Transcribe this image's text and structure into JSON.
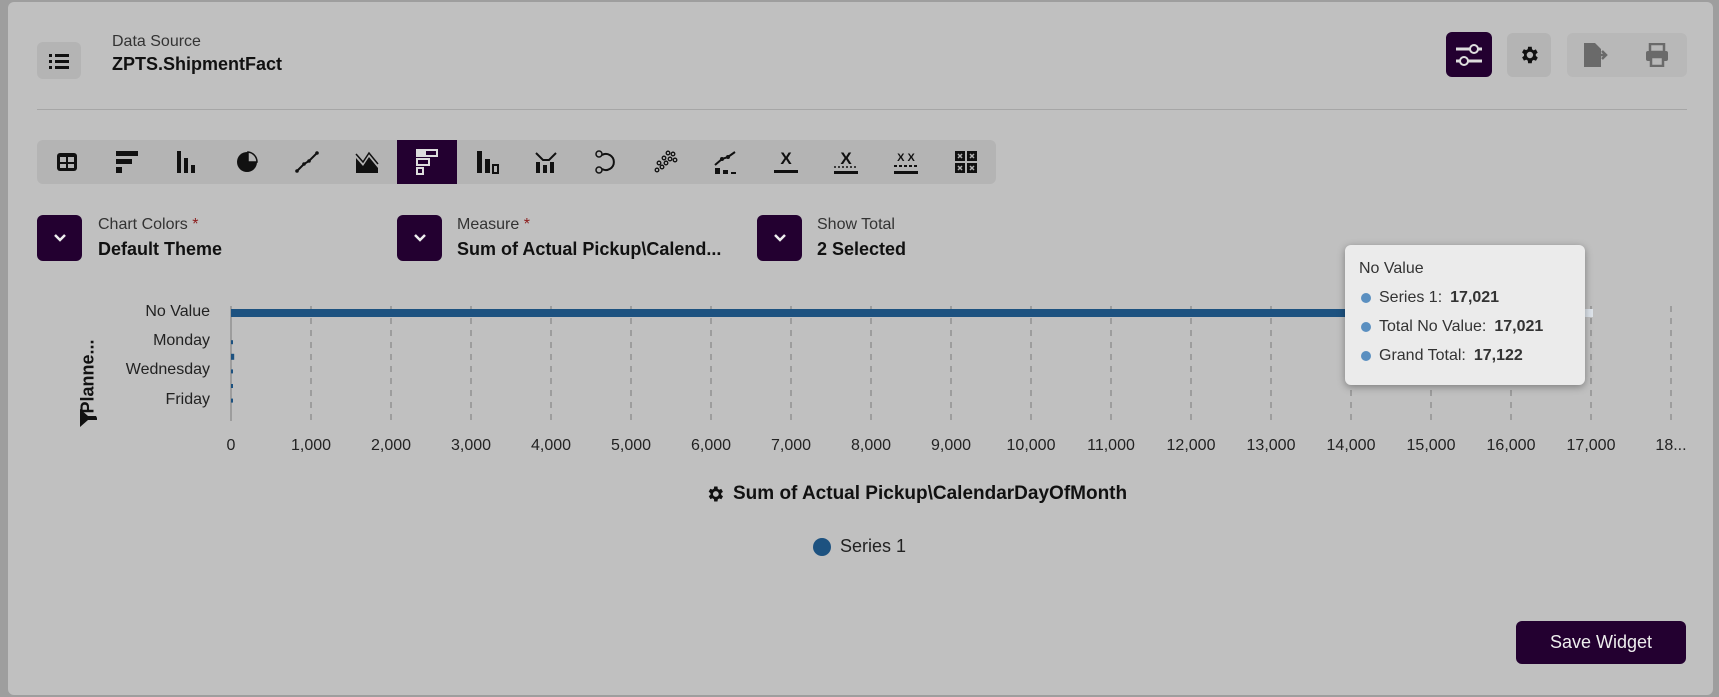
{
  "header": {
    "data_source_label": "Data Source",
    "data_source_value": "ZPTS.ShipmentFact"
  },
  "toolbar": {
    "chart_types": [
      "table",
      "horizontal-bar",
      "column",
      "pie",
      "line",
      "area",
      "stacked-bar",
      "stacked-column",
      "combo",
      "radar",
      "scatter",
      "pareto",
      "single-value",
      "single-value-trend",
      "multi-value",
      "value-grid"
    ],
    "active_index": 6
  },
  "controls": {
    "chart_colors": {
      "label": "Chart Colors",
      "required": "*",
      "value": "Default Theme"
    },
    "measure": {
      "label": "Measure",
      "required": "*",
      "value": "Sum of Actual Pickup\\Calend..."
    },
    "show_total": {
      "label": "Show Total",
      "value": "2 Selected"
    }
  },
  "colors": {
    "accent": "#230030",
    "series1": "#1d5280",
    "background": "#c0c0c0"
  },
  "chart_data": {
    "type": "bar",
    "orientation": "horizontal",
    "categories": [
      "No Value",
      "",
      "Monday",
      "",
      "Wednesday",
      "",
      "Friday",
      ""
    ],
    "series": [
      {
        "name": "Series 1",
        "values": [
          17021,
          0,
          15,
          40,
          15,
          15,
          16,
          0
        ]
      }
    ],
    "ylabel": "Planne...",
    "xlabel": "Sum of Actual Pickup\\CalendarDayOfMonth",
    "xlim": [
      0,
      18000
    ],
    "xticks": [
      "0",
      "1,000",
      "2,000",
      "3,000",
      "4,000",
      "5,000",
      "6,000",
      "7,000",
      "8,000",
      "9,000",
      "10,000",
      "11,000",
      "12,000",
      "13,000",
      "14,000",
      "15,000",
      "16,000",
      "17,000",
      "18..."
    ],
    "grid": "vertical-dashed",
    "legend": {
      "position": "bottom-center",
      "entries": [
        "Series 1"
      ]
    }
  },
  "tooltip": {
    "title": "No Value",
    "rows": [
      {
        "label": "Series 1:",
        "value": "17,021"
      },
      {
        "label": "Total No Value:",
        "value": "17,021"
      },
      {
        "label": "Grand Total:",
        "value": "17,122"
      }
    ]
  },
  "footer": {
    "save_label": "Save Widget"
  }
}
